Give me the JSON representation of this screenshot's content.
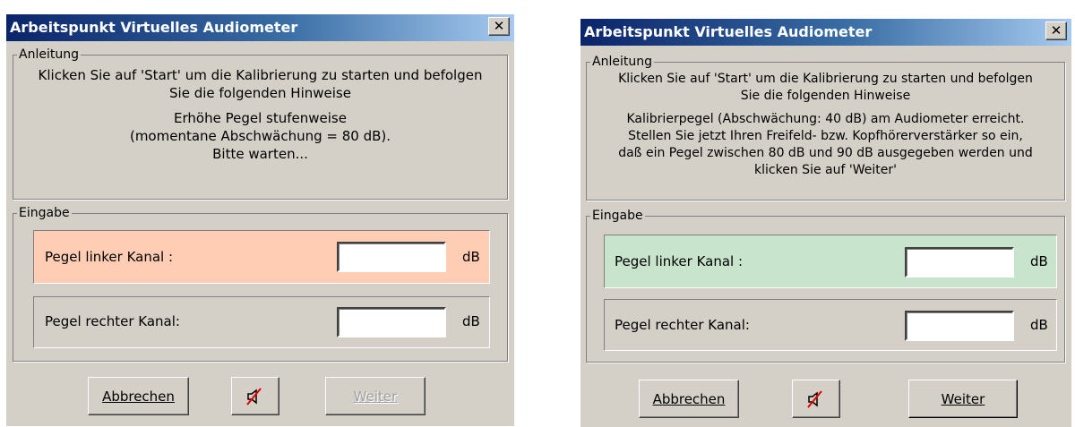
{
  "left": {
    "title": "Arbeitspunkt Virtuelles Audiometer",
    "anleitung_label": "Anleitung",
    "instruction_line1": "Klicken Sie auf 'Start' um die Kalibrierung zu starten und befolgen",
    "instruction_line2": "Sie die folgenden Hinweise",
    "status_lines": [
      "Erhöhe Pegel stufenweise",
      "(momentane Abschwächung = 80 dB).",
      "Bitte warten..."
    ],
    "eingabe_label": "Eingabe",
    "left_channel_label": "Pegel linker Kanal :",
    "left_channel_value": "",
    "left_channel_unit": "dB",
    "right_channel_label": "Pegel rechter Kanal:",
    "right_channel_value": "",
    "right_channel_unit": "dB",
    "cancel_label": "Abbrechen",
    "next_label": "Weiter",
    "next_enabled": false,
    "highlight_color": "#ffcdb4"
  },
  "right": {
    "title": "Arbeitspunkt Virtuelles Audiometer",
    "anleitung_label": "Anleitung",
    "instruction_line1": "Klicken Sie auf 'Start' um die Kalibrierung zu starten und befolgen",
    "instruction_line2": "Sie die folgenden Hinweise",
    "status_lines": [
      "Kalibrierpegel (Abschwächung: 40 dB) am Audiometer erreicht.",
      "Stellen Sie jetzt Ihren Freifeld- bzw. Kopfhörerverstärker so ein,",
      "daß ein Pegel zwischen 80 dB und 90 dB ausgegeben werden und",
      "klicken Sie auf 'Weiter'"
    ],
    "eingabe_label": "Eingabe",
    "left_channel_label": "Pegel linker Kanal :",
    "left_channel_value": "",
    "left_channel_unit": "dB",
    "right_channel_label": "Pegel rechter Kanal:",
    "right_channel_value": "",
    "right_channel_unit": "dB",
    "cancel_label": "Abbrechen",
    "next_label": "Weiter",
    "next_enabled": true,
    "highlight_color": "#c8e4cc"
  },
  "icons": {
    "close": "close-icon",
    "mute": "speaker-mute-icon"
  },
  "colors": {
    "dialog_bg": "#d4d0c8",
    "title_start": "#0a246a",
    "title_end": "#a6caf0"
  }
}
